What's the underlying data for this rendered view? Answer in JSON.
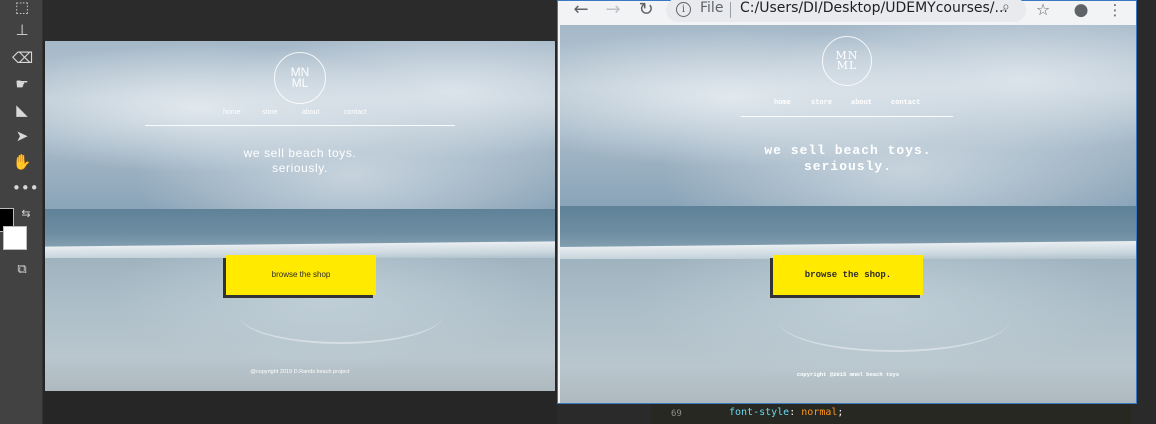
{
  "browser": {
    "scheme_label": "File",
    "url": "C:/Users/DI/Desktop/UDEMYcourses/..."
  },
  "mockup": {
    "logo_line1": "MN",
    "logo_line2": "ML",
    "nav": [
      "home",
      "store",
      "about",
      "contact"
    ],
    "headline_line1": "we sell beach toys.",
    "headline_line2": "seriously.",
    "cta": "browse the shop",
    "footer": "@copyright 2019 D.Rands beach project"
  },
  "website": {
    "logo_line1": "MN",
    "logo_line2": "ML",
    "nav": [
      "home",
      "store",
      "about",
      "contact"
    ],
    "headline_line1": "we sell beach toys.",
    "headline_line2": "seriously.",
    "cta": "browse the shop.",
    "footer": "copyright @2015 mnml beach toys"
  },
  "editor": {
    "lines": [
      {
        "num": "69",
        "code_prop": "font-style",
        "code_val": "normal"
      }
    ]
  },
  "colors": {
    "cta_yellow": "#ffea00",
    "browser_accent": "#3a78c2",
    "ps_panel": "#424242"
  }
}
